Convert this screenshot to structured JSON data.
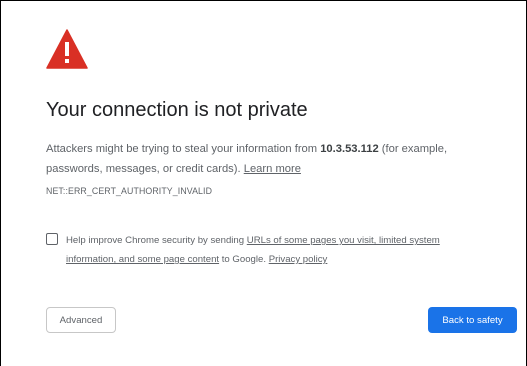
{
  "colors": {
    "warning_red": "#d93025",
    "primary_blue": "#1a73e8",
    "text_gray": "#5f6368",
    "heading_text": "#202124"
  },
  "icons": {
    "warning": "warning-triangle-icon"
  },
  "interstitial": {
    "heading": "Your connection is not private",
    "message": {
      "prefix": "Attackers might be trying to steal your information from ",
      "host": "10.3.53.112",
      "suffix": " (for example, passwords, messages, or credit cards). ",
      "learn_more": "Learn more"
    },
    "error_code": "NET::ERR_CERT_AUTHORITY_INVALID",
    "optin": {
      "checked": false,
      "prefix": "Help improve Chrome security by sending ",
      "link_text": "URLs of some pages you visit, limited system information, and some page content",
      "middle": " to Google. ",
      "privacy_link": "Privacy policy"
    },
    "buttons": {
      "advanced": "Advanced",
      "back_to_safety": "Back to safety"
    }
  }
}
